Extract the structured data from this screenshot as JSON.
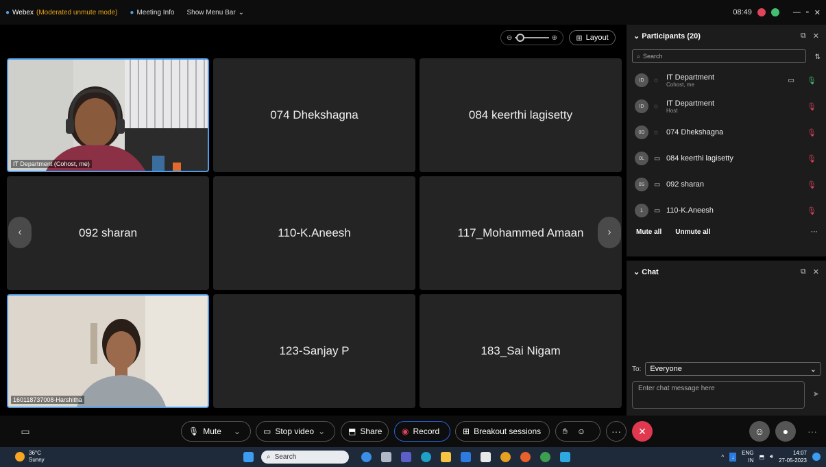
{
  "titlebar": {
    "app": "Webex",
    "mode": "(Moderated unmute mode)",
    "meeting_info": "Meeting Info",
    "show_menu": "Show Menu Bar",
    "time": "08:49"
  },
  "stage": {
    "layout_label": "Layout",
    "tiles": [
      {
        "name": "IT Department (Cohost, me)"
      },
      {
        "name": "074 Dhekshagna"
      },
      {
        "name": "084 keerthi lagisetty"
      },
      {
        "name": "092 sharan"
      },
      {
        "name": "110-K.Aneesh"
      },
      {
        "name": "117_Mohammed Amaan"
      },
      {
        "name": "160118737008-Harshitha"
      },
      {
        "name": "123-Sanjay P"
      },
      {
        "name": "183_Sai Nigam"
      }
    ]
  },
  "toolbar": {
    "mute": "Mute",
    "stop_video": "Stop video",
    "share": "Share",
    "record": "Record",
    "breakout": "Breakout sessions"
  },
  "participants": {
    "title": "Participants (20)",
    "search_placeholder": "Search",
    "list": [
      {
        "initials": "ID",
        "name": "IT Department",
        "role": "Cohost, me"
      },
      {
        "initials": "ID",
        "name": "IT Department",
        "role": "Host"
      },
      {
        "initials": "0D",
        "name": "074 Dhekshagna",
        "role": ""
      },
      {
        "initials": "0L",
        "name": "084 keerthi lagisetty",
        "role": ""
      },
      {
        "initials": "0S",
        "name": "092 sharan",
        "role": ""
      },
      {
        "initials": "1",
        "name": "110-K.Aneesh",
        "role": ""
      }
    ],
    "mute_all": "Mute all",
    "unmute_all": "Unmute all"
  },
  "chat": {
    "title": "Chat",
    "to_label": "To:",
    "to_value": "Everyone",
    "placeholder": "Enter chat message here"
  },
  "taskbar": {
    "temp": "36°C",
    "weather": "Sunny",
    "search": "Search",
    "lang": "ENG",
    "region": "IN",
    "time": "14:07",
    "date": "27-05-2023"
  }
}
